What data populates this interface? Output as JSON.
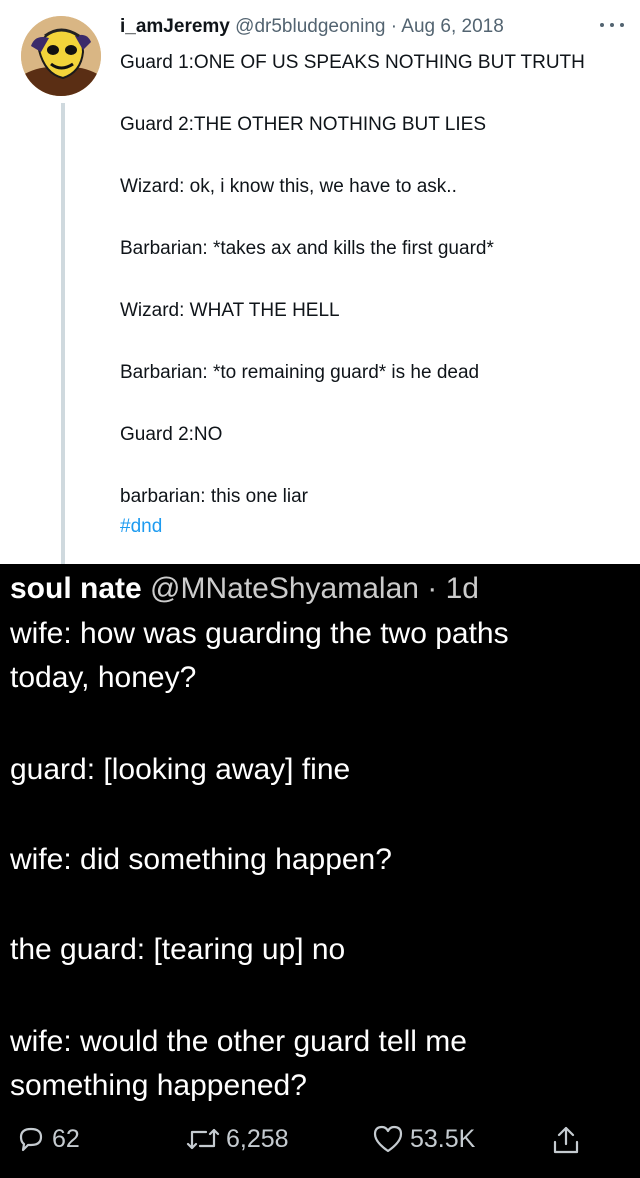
{
  "tweet1": {
    "display_name": "i_amJeremy",
    "handle": "@dr5bludgeoning",
    "separator": " · ",
    "date": "Aug 6, 2018",
    "lines": [
      "Guard 1:ONE OF US SPEAKS NOTHING BUT TRUTH",
      "Guard 2:THE OTHER NOTHING BUT LIES",
      "Wizard: ok, i know this, we have to ask..",
      "Barbarian: *takes ax and kills the first guard*",
      "Wizard: WHAT THE HELL",
      "Barbarian: *to remaining guard* is he dead",
      "Guard 2:NO",
      "barbarian: this one liar"
    ],
    "hashtag": "#dnd"
  },
  "tweet2": {
    "display_name": "soul nate",
    "handle": "@MNateShyamalan",
    "separator": " · ",
    "age": "1d",
    "lines": [
      "wife: how was guarding the two paths",
      "today, honey?",
      "guard: [looking away] fine",
      "wife: did something happen?",
      "the guard: [tearing up] no",
      "wife: would the other guard tell me",
      "something happened?"
    ],
    "actions": {
      "replies": "62",
      "retweets": "6,258",
      "likes": "53.5K"
    }
  },
  "icons": [
    "more-icon",
    "reply-icon",
    "retweet-icon",
    "like-icon",
    "share-icon"
  ],
  "colors": {
    "link": "#1d9bf0",
    "light_text": "#0f1419",
    "light_meta": "#536471",
    "dark_bg": "#000000",
    "dark_text": "#ffffff"
  }
}
